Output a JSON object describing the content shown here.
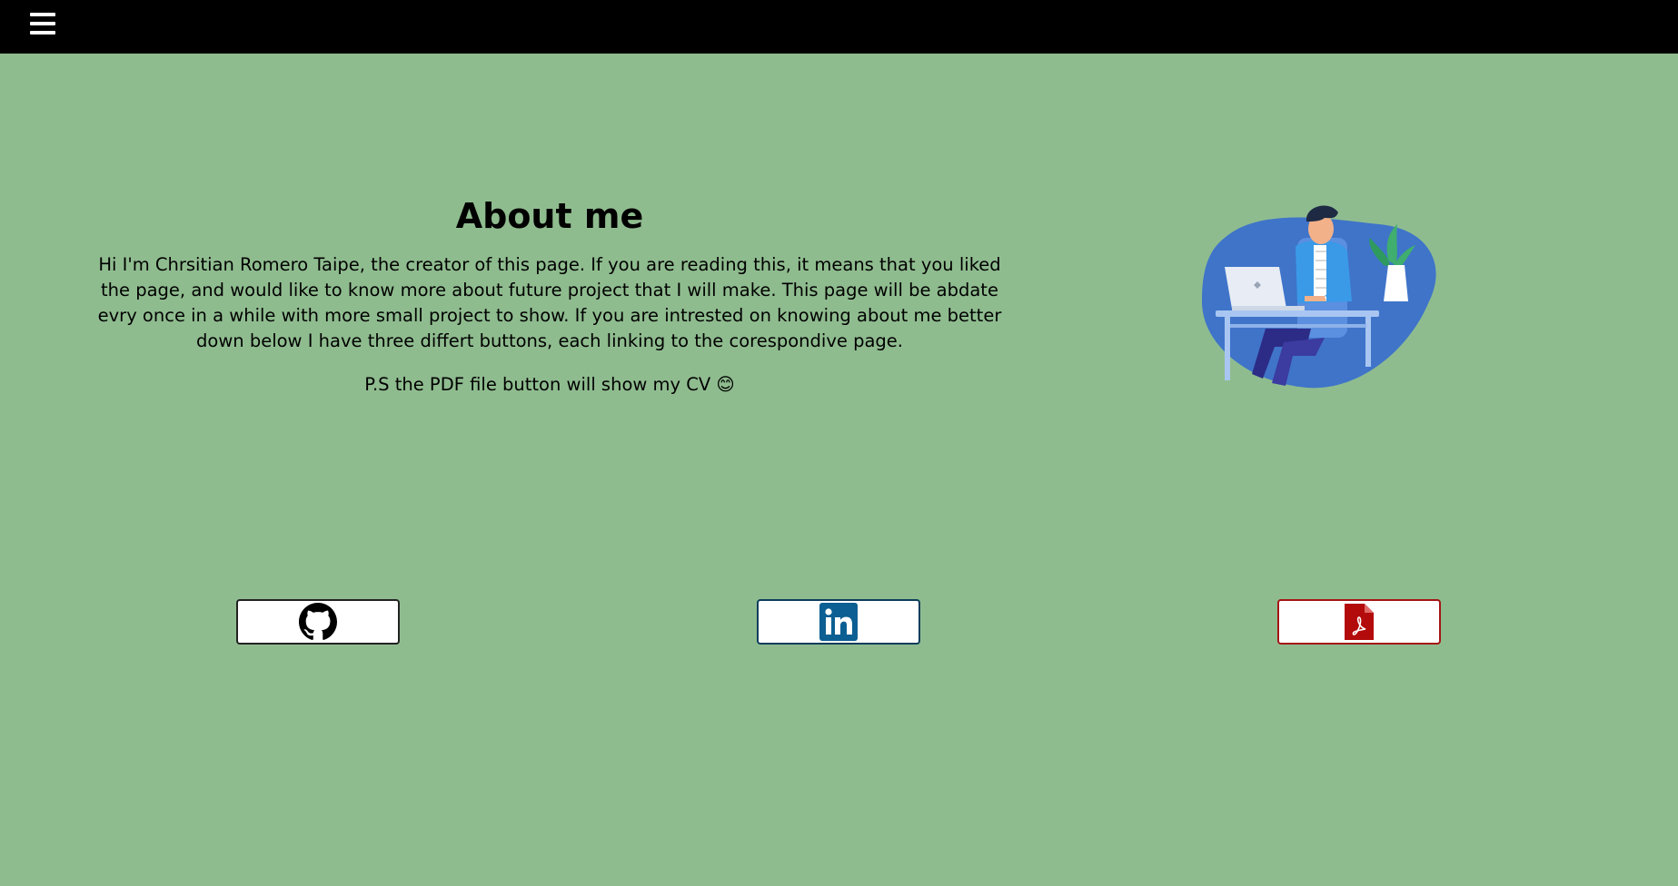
{
  "header": {
    "menu_icon": "hamburger-menu-icon",
    "background": "#000000"
  },
  "about": {
    "title": "About me",
    "body": "Hi I'm Chrsitian Romero Taipe, the creator of this page. If you are reading this, it means that you liked the page, and would like to know more about future project that I will make. This page will be abdate evry once in a while with more small project to show. If you are intrested on knowing about me better down below I have three differt buttons, each linking to the corespondive page.",
    "ps": "P.S the PDF file button will show my CV 😊"
  },
  "illustration": {
    "icon": "person-at-laptop-illustration"
  },
  "links": {
    "github": {
      "icon": "github-icon",
      "color": "#000000"
    },
    "linkedin": {
      "icon": "linkedin-icon",
      "color": "#0a66c2"
    },
    "pdf": {
      "icon": "pdf-file-icon",
      "color": "#b30b0b"
    }
  },
  "colors": {
    "page_background": "#8fbc8f",
    "text": "#000000"
  }
}
